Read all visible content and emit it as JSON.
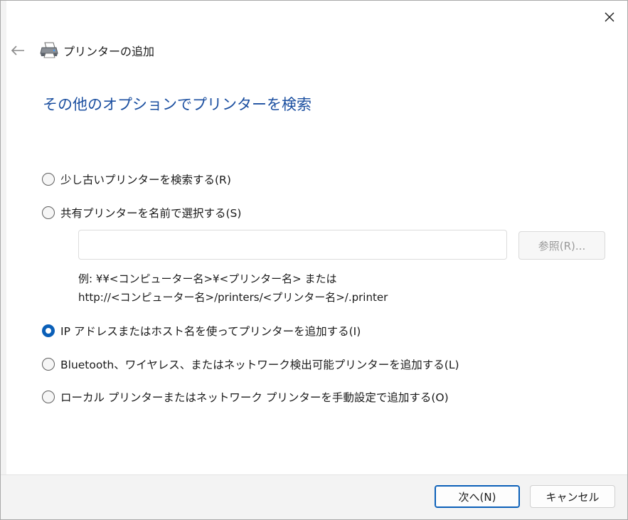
{
  "window": {
    "title": "プリンターの追加"
  },
  "page": {
    "heading": "その他のオプションでプリンターを検索"
  },
  "options": [
    {
      "label": "少し古いプリンターを検索する(R)",
      "checked": false
    },
    {
      "label": "共有プリンターを名前で選択する(S)",
      "checked": false
    },
    {
      "label": "IP アドレスまたはホスト名を使ってプリンターを追加する(I)",
      "checked": true
    },
    {
      "label": "Bluetooth、ワイヤレス、またはネットワーク検出可能プリンターを追加する(L)",
      "checked": false
    },
    {
      "label": "ローカル プリンターまたはネットワーク プリンターを手動設定で追加する(O)",
      "checked": false
    }
  ],
  "share": {
    "value": "",
    "browse_label": "参照(R)...",
    "example_line1": "例: ¥¥<コンピューター名>¥<プリンター名> または",
    "example_line2": "http://<コンピューター名>/printers/<プリンター名>/.printer"
  },
  "footer": {
    "next_label": "次へ(N)",
    "cancel_label": "キャンセル"
  },
  "icons": {
    "close": "close-icon",
    "back": "back-arrow-icon",
    "printer": "printer-icon"
  },
  "colors": {
    "accent": "#0a5fb8",
    "heading": "#1b4fa0"
  }
}
